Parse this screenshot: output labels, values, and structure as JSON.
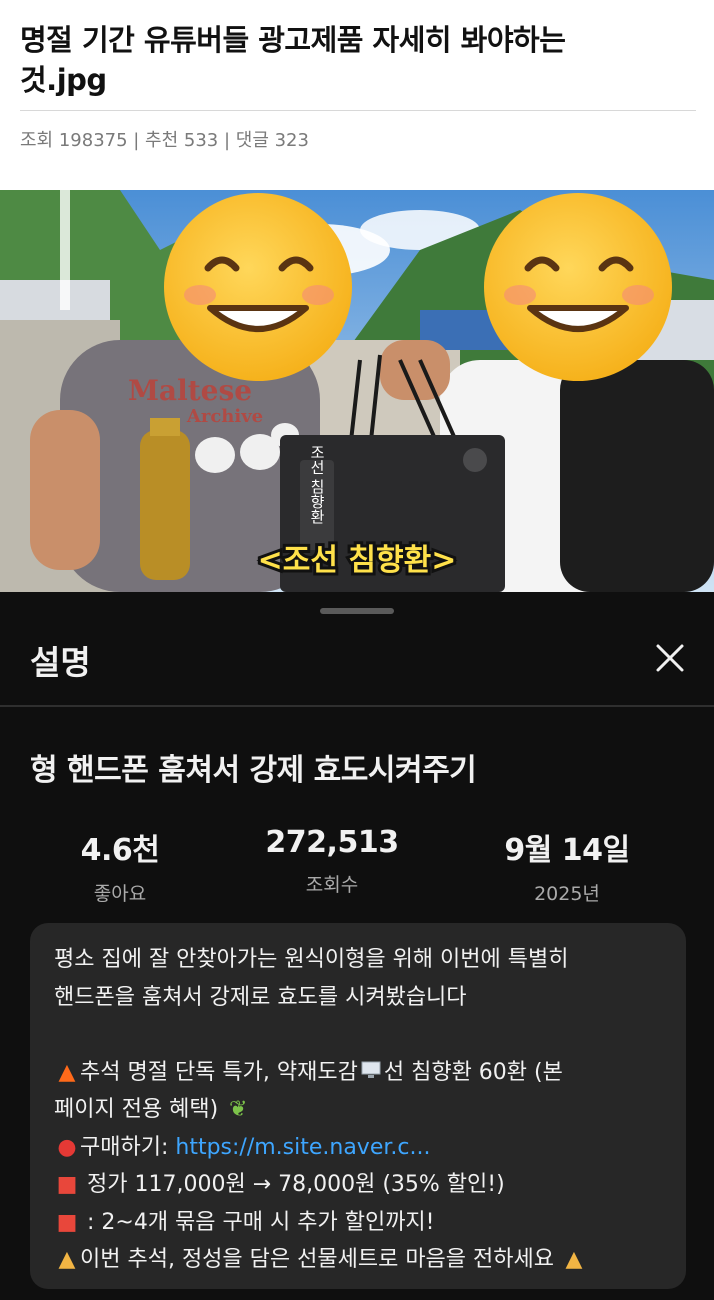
{
  "post": {
    "title": "명절 기간 유튜버들 광고제품 자세히 봐야하는 것.jpg",
    "meta": "조회 198375 | 추천 533 | 댓글 323"
  },
  "video_frame": {
    "caption": "<조선 침향환>",
    "tshirt_text_1": "Maltese",
    "tshirt_text_2": "Archive",
    "bag_text": "조선 침향환"
  },
  "sheet": {
    "title": "설명",
    "video_title": "형 핸드폰 훔쳐서 강제 효도시켜주기",
    "stats": {
      "likes_value": "4.6천",
      "likes_label": "좋아요",
      "views_value": "272,513",
      "views_label": "조회수",
      "date_value": "9월 14일",
      "date_label": "2025년"
    },
    "description": {
      "line1": "평소 집에 잘 안찾아가는 원식이형을 위해 이번에 특별히",
      "line2": "핸드폰을 훔쳐서 강제로 효도를 시켜봤습니다",
      "promo_line1": "추석 명절 단독 특가, 약재도감",
      "promo_line1_b": "선 침향환 60환 (본",
      "promo_line2": "페이지 전용 혜택)",
      "buy_label": "구매하기: ",
      "buy_link": "https://m.site.naver.c...",
      "price_line": " 정가 117,000원 → 78,000원 (35% 할인!)",
      "bundle_line": "  : 2~4개 묶음 구매 시 추가 할인까지!",
      "closing_line": "이번 추석, 정성을 담은 선물세트로 마음을 전하세요 "
    }
  },
  "icons": {
    "close": "close-icon",
    "fire": "fire-icon",
    "monitor": "monitor-icon",
    "leaf": "leaf-icon",
    "pin": "pin-icon",
    "gift": "gift-icon",
    "pray": "folded-hands-icon"
  }
}
